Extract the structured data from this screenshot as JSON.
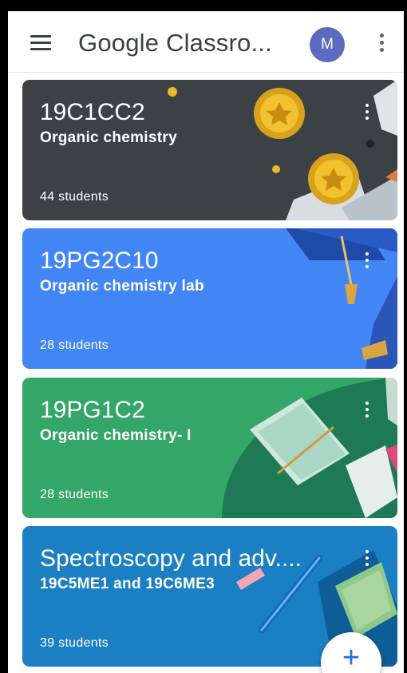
{
  "app": {
    "title": "Google Classro...",
    "avatar_initial": "M",
    "menu_icon": "hamburger-menu-icon",
    "overflow_icon": "more-vert-icon"
  },
  "classes": [
    {
      "code": "19C1CC2",
      "name": "Organic chemistry",
      "students": "44 students",
      "color": "#3c4145"
    },
    {
      "code": "19PG2C10",
      "name": "Organic chemistry lab",
      "students": "28 students",
      "color": "#4285f4"
    },
    {
      "code": "19PG1C2",
      "name": "Organic chemistry- I",
      "students": "28 students",
      "color": "#34a668"
    },
    {
      "code": "Spectroscopy and adv....",
      "name": "19C5ME1 and 19C6ME3",
      "students": "39 students",
      "color": "#1b7fc4"
    }
  ],
  "fab": {
    "icon": "add-icon",
    "label": "+"
  },
  "colors": {
    "avatar": "#5c6bc0",
    "fab_plus": "#1a73e8"
  }
}
